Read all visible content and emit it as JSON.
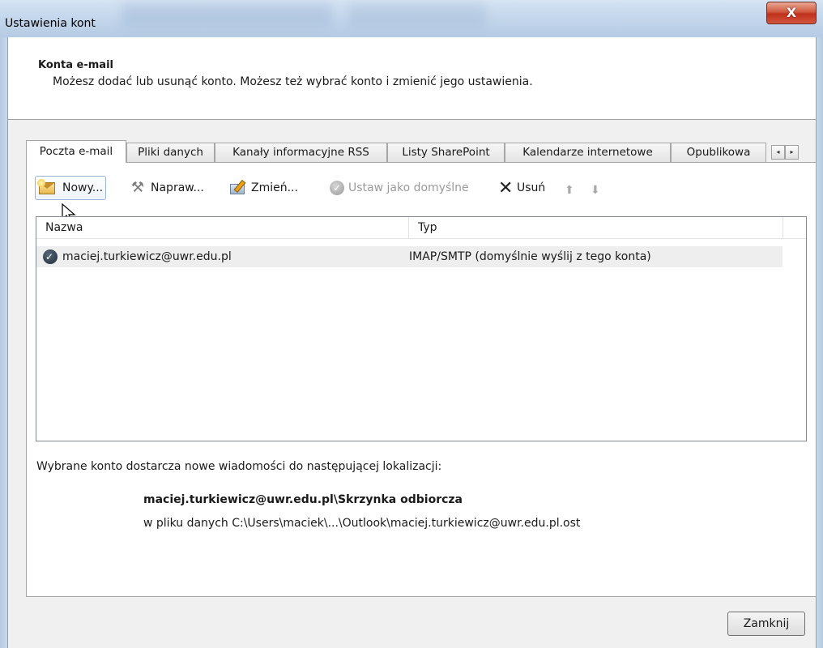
{
  "window": {
    "title": "Ustawienia kont",
    "close_glyph": "X"
  },
  "header": {
    "title": "Konta e-mail",
    "description": "Możesz dodać lub usunąć konto. Możesz też wybrać konto i zmienić jego ustawienia."
  },
  "tabs": [
    {
      "label": "Poczta e-mail",
      "active": true
    },
    {
      "label": "Pliki danych",
      "active": false
    },
    {
      "label": "Kanały informacyjne RSS",
      "active": false
    },
    {
      "label": "Listy SharePoint",
      "active": false
    },
    {
      "label": "Kalendarze internetowe",
      "active": false
    },
    {
      "label": "Opublikowa",
      "active": false
    }
  ],
  "tab_scroll": {
    "left_glyph": "◂",
    "right_glyph": "▸"
  },
  "toolbar": {
    "new_label": "Nowy...",
    "repair_label": "Napraw...",
    "change_label": "Zmień...",
    "set_default_label": "Ustaw jako domyślne",
    "remove_label": "Usuń",
    "move_up_glyph": "⬆",
    "move_down_glyph": "⬇",
    "tools_glyph": "⚒",
    "check_glyph": "✓",
    "remove_glyph": "✕"
  },
  "icons": {
    "new": "envelope-new-icon",
    "repair": "tools-icon",
    "change": "account-change-icon",
    "set_default": "check-circle-icon",
    "remove": "x-icon",
    "move_up": "arrow-up-icon",
    "move_down": "arrow-down-icon",
    "account": "account-check-icon"
  },
  "accounts_table": {
    "columns": [
      "Nazwa",
      "Typ"
    ],
    "rows": [
      {
        "name": "maciej.turkiewicz@uwr.edu.pl",
        "type": "IMAP/SMTP (domyślnie wyślij z tego konta)"
      }
    ]
  },
  "delivery": {
    "label": "Wybrane konto dostarcza nowe wiadomości do następującej lokalizacji:",
    "folder": "maciej.turkiewicz@uwr.edu.pl\\Skrzynka odbiorcza",
    "file": "w pliku danych C:\\Users\\maciek\\...\\Outlook\\maciej.turkiewicz@uwr.edu.pl.ost"
  },
  "footer": {
    "close_label": "Zamknij"
  },
  "colors": {
    "titlebar": "#c3d6ec",
    "close_button": "#c0301c",
    "dialog_background": "#f0f0f0",
    "selected_row": "#eeeeee"
  }
}
